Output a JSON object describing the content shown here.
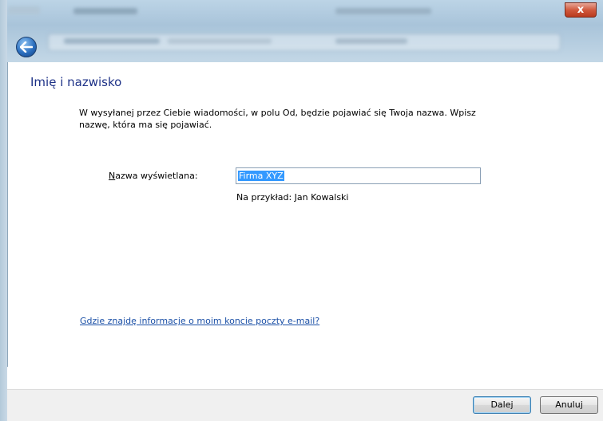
{
  "window": {
    "close_glyph": "x"
  },
  "page": {
    "title": "Imię i nazwisko",
    "description": "W wysyłanej przez Ciebie wiadomości, w polu Od, będzie pojawiać się Twoja nazwa. Wpisz nazwę, która ma się pojawiać."
  },
  "form": {
    "display_name_label_accel": "N",
    "display_name_label_rest": "azwa wyświetlana:",
    "display_name_value": "Firma XYZ",
    "example": "Na przykład: Jan Kowalski"
  },
  "help_link": "Gdzie znajdę informacje o moim koncie poczty e-mail?",
  "buttons": {
    "next": "Dalej",
    "cancel": "Anuluj"
  },
  "colors": {
    "title": "#1e3287",
    "link": "#1a4fa6",
    "selection": "#3399ff"
  },
  "icons": {
    "back": "back-arrow-icon",
    "close": "close-icon"
  }
}
